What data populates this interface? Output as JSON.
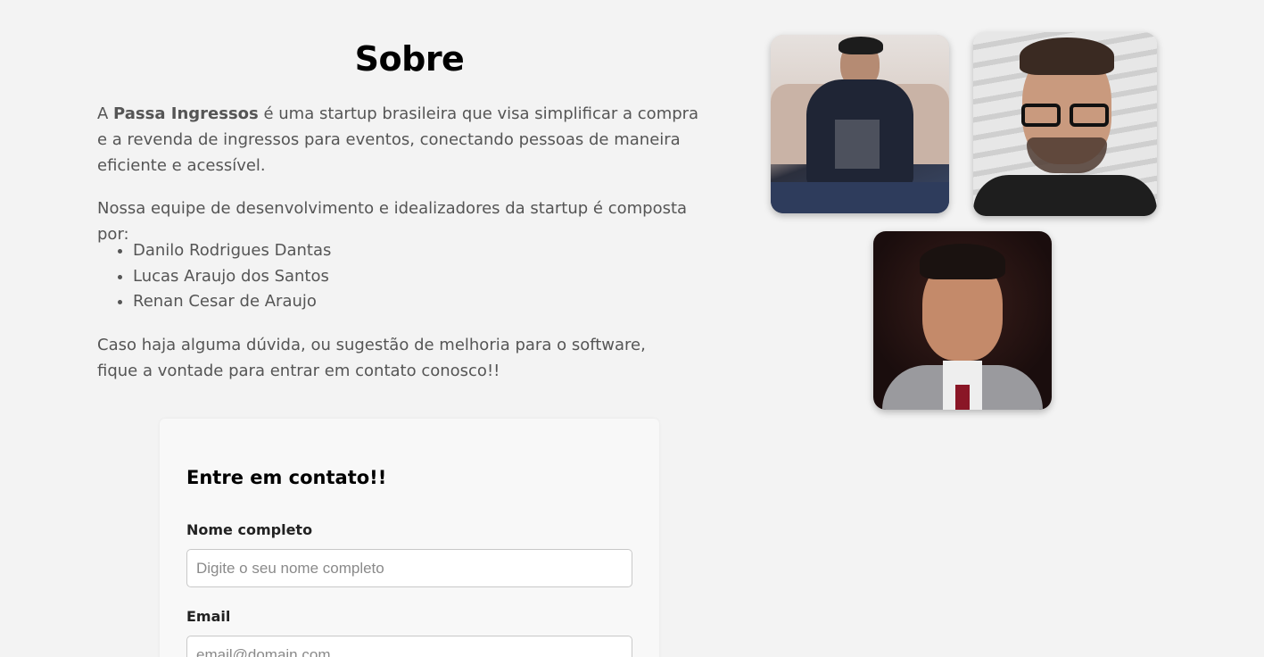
{
  "about": {
    "title": "Sobre",
    "intro_prefix": "A ",
    "intro_brand": "Passa Ingressos",
    "intro_suffix": " é uma startup brasileira que visa simplificar a compra e a revenda de ingressos para eventos, conectando pessoas de maneira eficiente e acessível.",
    "team_intro": "Nossa equipe de desenvolvimento e idealizadores da startup é composta por:",
    "team": [
      "Danilo Rodrigues Dantas",
      "Lucas Araujo dos Santos",
      "Renan Cesar de Araujo"
    ],
    "contact_note": "Caso haja alguma dúvida, ou sugestão de melhoria para o software, fique a vontade para entrar em contato conosco!!"
  },
  "contact_form": {
    "title": "Entre em contato!!",
    "name_label": "Nome completo",
    "name_placeholder": "Digite o seu nome completo",
    "email_label": "Email",
    "email_placeholder": "email@domain.com"
  },
  "photos": [
    {
      "icon": "team-member-photo"
    },
    {
      "icon": "team-member-photo"
    },
    {
      "icon": "team-member-photo"
    }
  ]
}
